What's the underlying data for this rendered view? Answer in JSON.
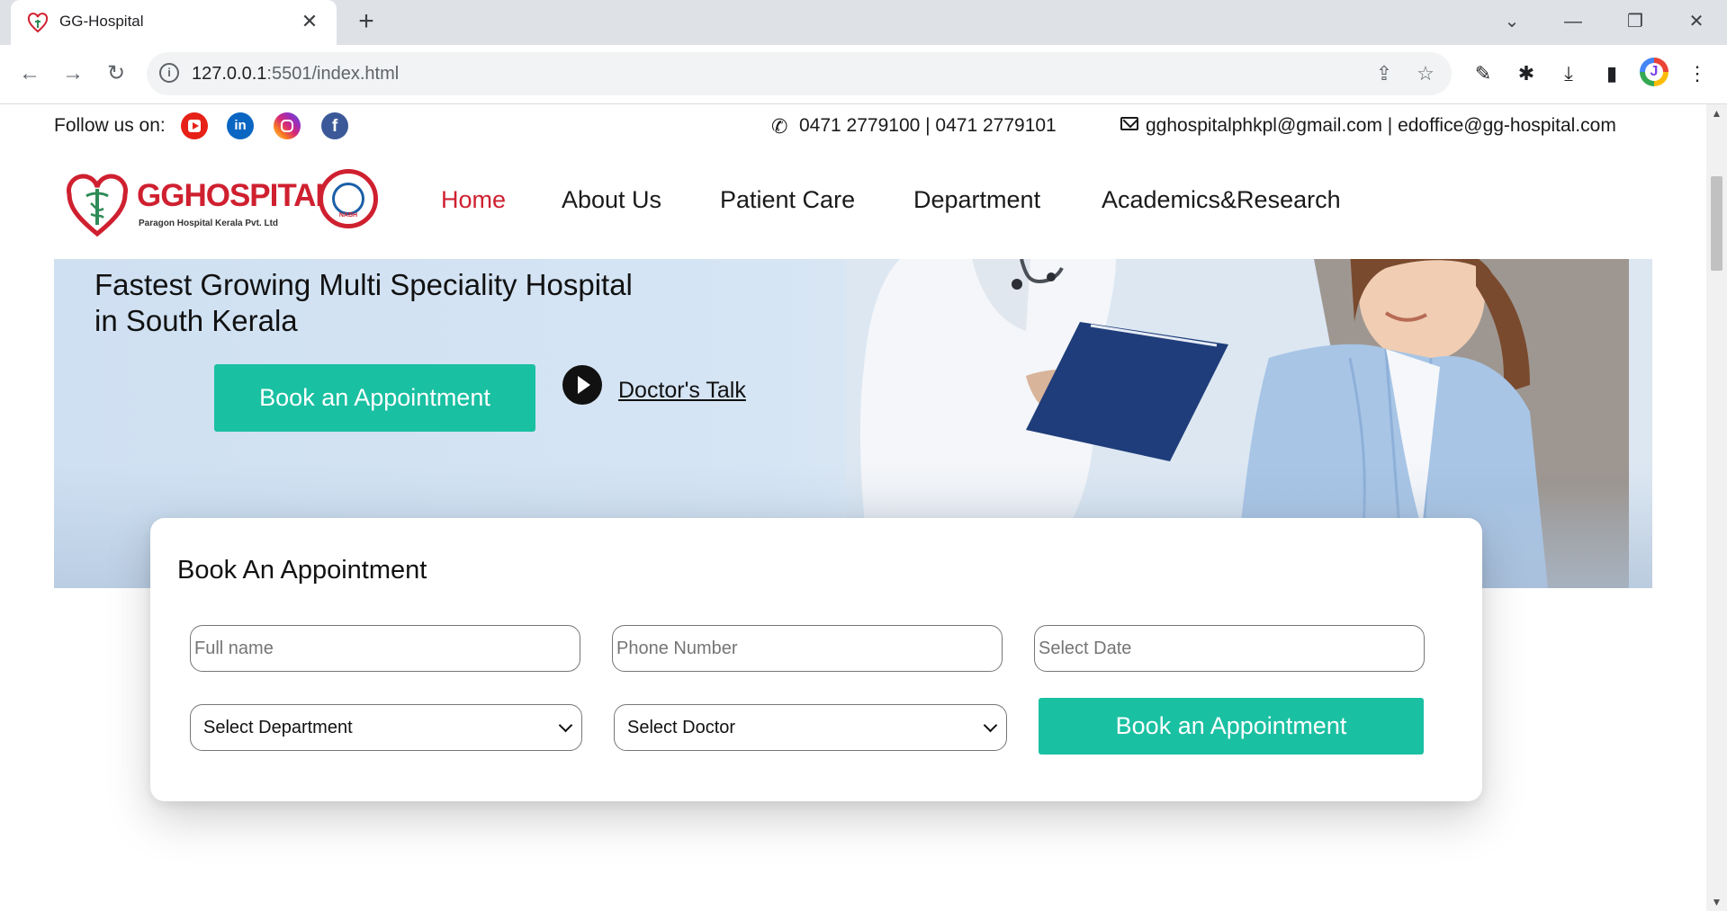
{
  "browser": {
    "tab_title": "GG-Hospital",
    "url_host": "127.0.0.1",
    "url_path": ":5501/index.html"
  },
  "topbar": {
    "follow_label": "Follow us on:",
    "social": [
      "youtube-icon",
      "linkedin-icon",
      "instagram-icon",
      "facebook-icon"
    ],
    "phone": "0471 2779100 | 0471 2779101",
    "email": "gghospitalphkpl@gmail.com | edoffice@gg-hospital.com"
  },
  "logo": {
    "word_gg": "GG",
    "word_hospital": "HOSPITAL",
    "subtitle": "Paragon Hospital Kerala Pvt. Ltd",
    "seal_text": "NABH"
  },
  "nav": {
    "items": [
      "Home",
      "About Us",
      "Patient Care",
      "Department",
      "Academics&Research"
    ],
    "active": "Home"
  },
  "hero": {
    "line1": "Fastest Growing Multi Speciality Hospital",
    "line2": "in South Kerala",
    "cta": "Book an Appointment",
    "talk": "Doctor's Talk"
  },
  "appointment": {
    "title": "Book An Appointment",
    "name_placeholder": "Full name",
    "phone_placeholder": "Phone Number",
    "date_placeholder": "Select Date",
    "department_value": "Select Department",
    "doctor_value": "Select Doctor",
    "submit": "Book an Appointment"
  },
  "colors": {
    "accent": "#1ac0a2",
    "brand_red": "#cf2030",
    "hero_bg": "#d6e5f4"
  }
}
